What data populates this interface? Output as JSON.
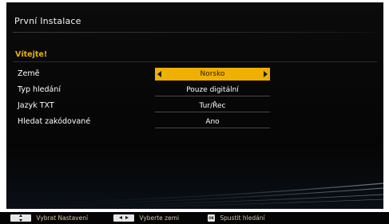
{
  "screen": {
    "title": "První Instalace",
    "welcome": "Vítejte!"
  },
  "settings": [
    {
      "label": "Země",
      "value": "Norsko",
      "selected": true
    },
    {
      "label": "Typ hledání",
      "value": "Pouze digitální",
      "selected": false
    },
    {
      "label": "Jazyk TXT",
      "value": "Tur/Řec",
      "selected": false
    },
    {
      "label": "Hledat zakódované",
      "value": "Ano",
      "selected": false
    }
  ],
  "footer": {
    "hint_select": "Vybrat Nastavení",
    "hint_country": "Vyberte zemi",
    "ok_key_label": "OK",
    "hint_start": "Spustit hledání"
  },
  "icons": {
    "left": "arrow-left-icon",
    "right": "arrow-right-icon",
    "updown": "up-down-key-icon",
    "leftright": "left-right-key-icon",
    "ok": "ok-key-icon"
  },
  "colors": {
    "accent": "#f0b000",
    "background": "#070707",
    "text": "#ffffff"
  }
}
